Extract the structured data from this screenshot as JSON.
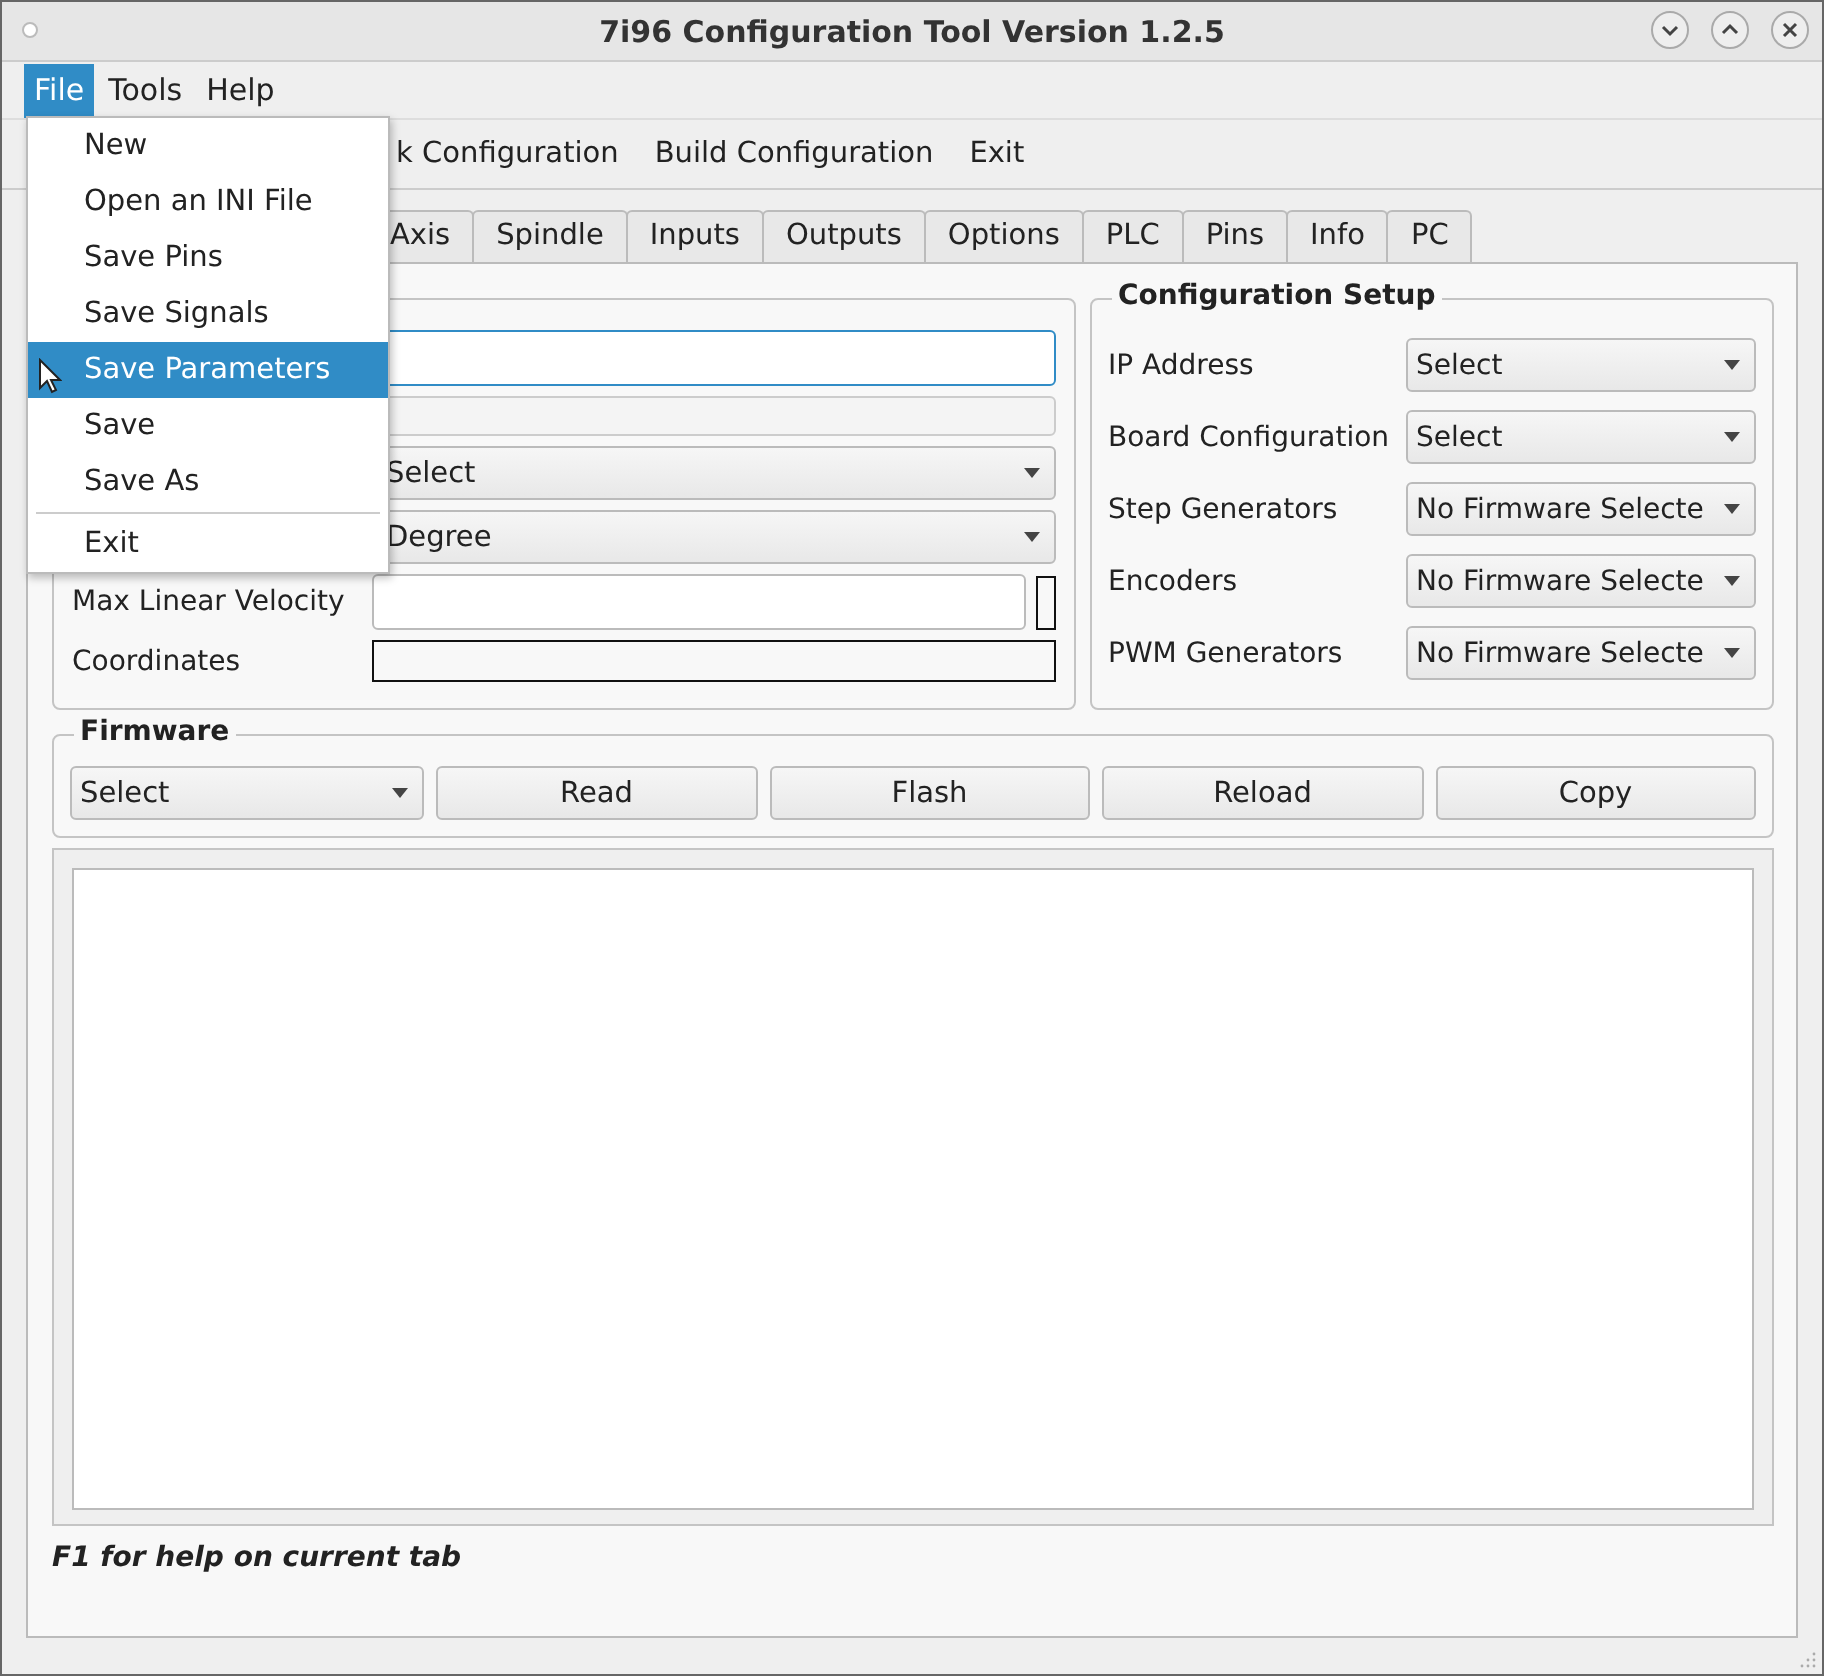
{
  "window": {
    "title": "7i96 Configuration Tool Version 1.2.5"
  },
  "menubar": [
    {
      "label": "File",
      "open": true
    },
    {
      "label": "Tools",
      "open": false
    },
    {
      "label": "Help",
      "open": false
    }
  ],
  "toolbar": [
    {
      "label": "k Configuration"
    },
    {
      "label": "Build Configuration"
    },
    {
      "label": "Exit"
    }
  ],
  "tabs": [
    {
      "label": "Axis"
    },
    {
      "label": "Spindle"
    },
    {
      "label": "Inputs"
    },
    {
      "label": "Outputs"
    },
    {
      "label": "Options"
    },
    {
      "label": "PLC"
    },
    {
      "label": "Pins"
    },
    {
      "label": "Info"
    },
    {
      "label": "PC"
    }
  ],
  "machine_fields": [
    {
      "kind": "input",
      "focused": true
    },
    {
      "kind": "input",
      "focused": false,
      "disabled": true
    },
    {
      "kind": "combo",
      "value": "Select"
    },
    {
      "kind": "combo",
      "value": "Degree"
    },
    {
      "kind": "input",
      "label": "Max Linear Velocity",
      "focused": false,
      "indicator": true
    },
    {
      "kind": "display",
      "label": "Coordinates"
    }
  ],
  "configuration_setup": {
    "title": "Configuration Setup",
    "rows": [
      {
        "label": "IP Address",
        "value": "Select"
      },
      {
        "label": "Board Configuration",
        "value": "Select"
      },
      {
        "label": "Step Generators",
        "value": "No Firmware Selecte"
      },
      {
        "label": "Encoders",
        "value": "No Firmware Selecte"
      },
      {
        "label": "PWM Generators",
        "value": "No Firmware Selecte"
      }
    ]
  },
  "firmware": {
    "title": "Firmware",
    "value": "Select",
    "buttons": [
      "Read",
      "Flash",
      "Reload",
      "Copy"
    ]
  },
  "help_text": "F1 for help on current tab",
  "file_menu": [
    {
      "kind": "item",
      "label": "New",
      "selected": false
    },
    {
      "kind": "item",
      "label": "Open an INI File",
      "selected": false
    },
    {
      "kind": "item",
      "label": "Save Pins",
      "selected": false
    },
    {
      "kind": "item",
      "label": "Save Signals",
      "selected": false
    },
    {
      "kind": "item",
      "label": "Save Parameters",
      "selected": true
    },
    {
      "kind": "item",
      "label": "Save",
      "selected": false
    },
    {
      "kind": "item",
      "label": "Save As",
      "selected": false
    },
    {
      "kind": "separator"
    },
    {
      "kind": "item",
      "label": "Exit",
      "selected": false
    }
  ]
}
